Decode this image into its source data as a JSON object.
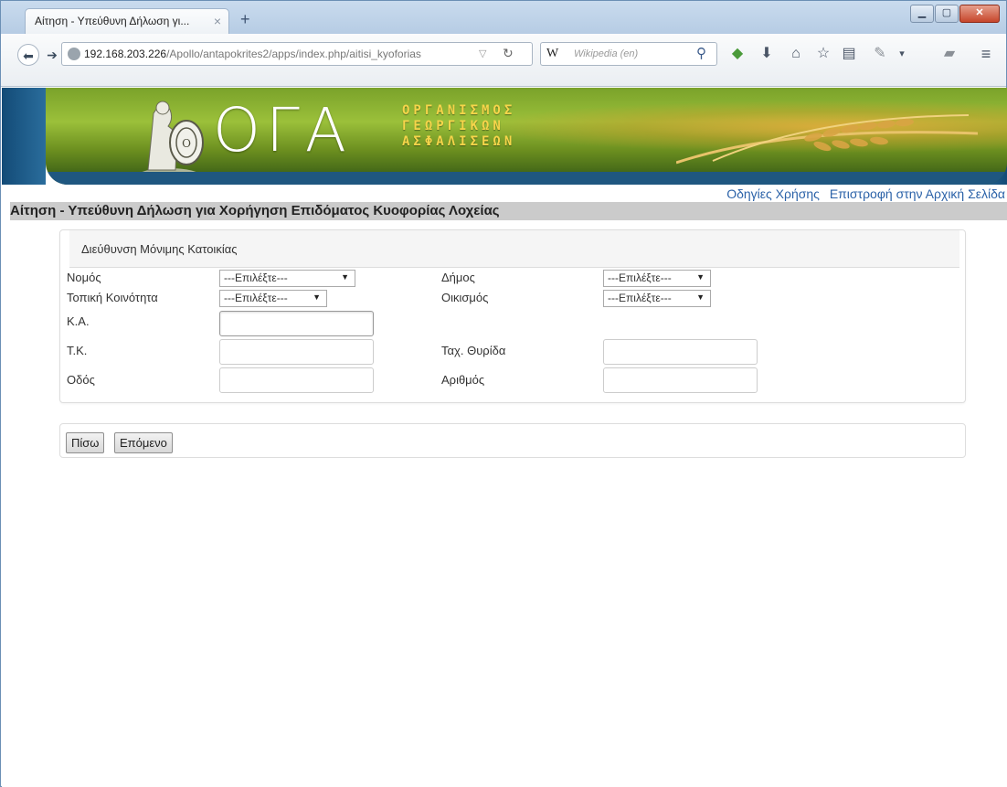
{
  "browser": {
    "tab_title": "Αίτηση - Υπεύθυνη Δήλωση γι...",
    "tab_close": "×",
    "new_tab": "+",
    "url_host": "192.168.203.226",
    "url_path": "/Apollo/antapokrites2/apps/index.php/aitisi_kyoforias",
    "search_engine_symbol": "W",
    "search_placeholder": "Wikipedia (en)"
  },
  "banner": {
    "logo": "ΟΓΑ",
    "org_line1": "ΟΡΓΑΝΙΣΜΟΣ",
    "org_line2": "ΓΕΩΡΓΙΚΩΝ",
    "org_line3": "ΑΣΦΑΛΙΣΕΩΝ",
    "colors": {
      "field": "#8fb334",
      "side": "#1f5780",
      "logo_text": "#ffffff",
      "org_text": "#f6d54a"
    }
  },
  "nav_links": {
    "help": "Οδηγίες Χρήσης",
    "home": "Επιστροφή στην Αρχική Σελίδα"
  },
  "page_title": "Αίτηση - Υπεύθυνη Δήλωση για Χορήγηση Επιδόματος Κυοφορίας Λοχείας",
  "address_panel": {
    "heading": "Διεύθυνση Μόνιμης Κατοικίας",
    "fields": {
      "nomos": {
        "label": "Νομός",
        "value": "---Επιλέξτε---"
      },
      "dimos": {
        "label": "Δήμος",
        "value": "---Επιλέξτε---"
      },
      "topiki_koinotita": {
        "label": "Τοπική Κοινότητα",
        "value": "---Επιλέξτε---"
      },
      "oikismos": {
        "label": "Οικισμός",
        "value": "---Επιλέξτε---"
      },
      "ka": {
        "label": "Κ.Α.",
        "value": ""
      },
      "tk": {
        "label": "Τ.Κ.",
        "value": ""
      },
      "tax_thyrida": {
        "label": "Ταχ. Θυρίδα",
        "value": ""
      },
      "odos": {
        "label": "Οδός",
        "value": ""
      },
      "arithmos": {
        "label": "Αριθμός",
        "value": ""
      }
    }
  },
  "actions": {
    "back": "Πίσω",
    "next": "Επόμενο"
  },
  "icons": [
    "back-icon",
    "forward-icon",
    "globe-icon",
    "reload-icon",
    "search-icon",
    "addon-icon",
    "download-icon",
    "home-icon",
    "bookmark-star-icon",
    "reader-icon",
    "menu-icon"
  ]
}
